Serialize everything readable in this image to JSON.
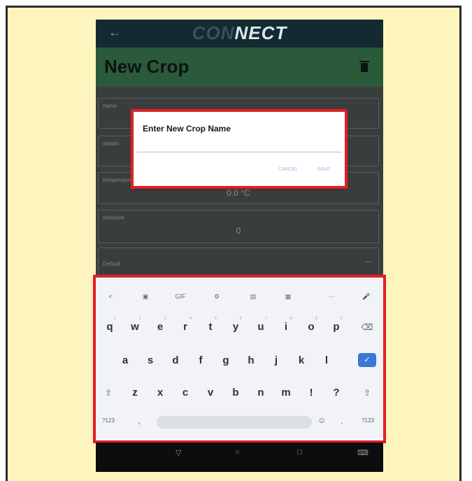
{
  "app": {
    "logo_part1": "CON",
    "logo_part2": "NECT",
    "back_icon": "←",
    "page_title": "New Crop"
  },
  "form": {
    "fields": [
      {
        "label": "name",
        "value": ""
      },
      {
        "label": "details",
        "value": ""
      },
      {
        "label": "temperature",
        "value": "0.0 °C"
      },
      {
        "label": "moisture",
        "value": "0"
      },
      {
        "label": "Default",
        "value": ""
      }
    ]
  },
  "dialog": {
    "title": "Enter New Crop Name",
    "input_value": "",
    "cancel_label": "CANCEL",
    "save_label": "SAVE"
  },
  "keyboard": {
    "toolbar": [
      "<",
      "▣",
      "GIF",
      "⚙",
      "▤",
      "▦",
      "···",
      "🎤"
    ],
    "row1": [
      "q",
      "w",
      "e",
      "r",
      "t",
      "y",
      "u",
      "i",
      "o",
      "p"
    ],
    "row1_hints": [
      "1",
      "2",
      "3",
      "4",
      "5",
      "6",
      "7",
      "8",
      "9",
      "0"
    ],
    "row2": [
      "a",
      "s",
      "d",
      "f",
      "g",
      "h",
      "j",
      "k",
      "l"
    ],
    "row3": [
      "z",
      "x",
      "c",
      "v",
      "b",
      "n",
      "m",
      "!",
      "?"
    ],
    "symbols_left": "?123",
    "symbols_right": "?123",
    "comma": ",",
    "period": ".",
    "enter_glyph": "✓",
    "backspace_glyph": "⌫",
    "shift_glyph": "⇧",
    "emoji_glyph": "☺"
  },
  "navbar": {
    "back": "▽",
    "home": "○",
    "recents": "□",
    "keyboard": "⌨"
  },
  "colors": {
    "status_bar": "#132a32",
    "title_bar": "#2b5a3a",
    "highlight": "#e31e26",
    "background": "#fdf5bd",
    "enter_key": "#3b78d6"
  }
}
